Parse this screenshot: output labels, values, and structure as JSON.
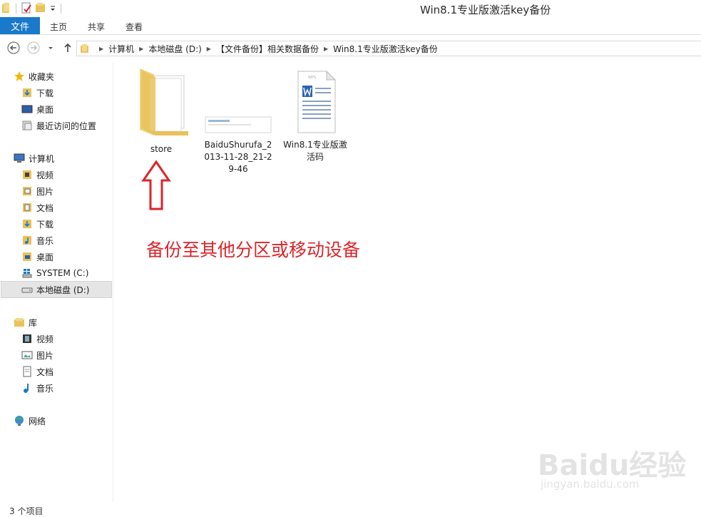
{
  "window": {
    "title": "Win8.1专业版激活key备份"
  },
  "ribbon": {
    "file_tab": "文件",
    "tabs": [
      "主页",
      "共享",
      "查看"
    ]
  },
  "address": {
    "crumbs": [
      "计算机",
      "本地磁盘 (D:)",
      "【文件备份】相关数据备份",
      "Win8.1专业版激活key备份"
    ]
  },
  "sidebar": {
    "favorites": {
      "label": "收藏夹",
      "items": [
        "下载",
        "桌面",
        "最近访问的位置"
      ]
    },
    "computer": {
      "label": "计算机",
      "items": [
        "视频",
        "图片",
        "文档",
        "下载",
        "音乐",
        "桌面",
        "SYSTEM (C:)",
        "本地磁盘 (D:)"
      ]
    },
    "libraries": {
      "label": "库",
      "items": [
        "视频",
        "图片",
        "文档",
        "音乐"
      ]
    },
    "network": {
      "label": "网络"
    }
  },
  "files": [
    {
      "name": "store",
      "type": "folder"
    },
    {
      "name": "BaiduShurufa_2013-11-28_21-29-46",
      "type": "image"
    },
    {
      "name": "Win8.1专业版激活码",
      "type": "wps-document"
    }
  ],
  "annotation": {
    "text": "备份至其他分区或移动设备",
    "color": "#d9262b"
  },
  "status": {
    "count_text": "3 个项目"
  },
  "watermark": {
    "brand": "Baidu经验",
    "url": "jingyan.baidu.com"
  },
  "colors": {
    "accent": "#1979ca",
    "folder": "#e8c25a"
  }
}
